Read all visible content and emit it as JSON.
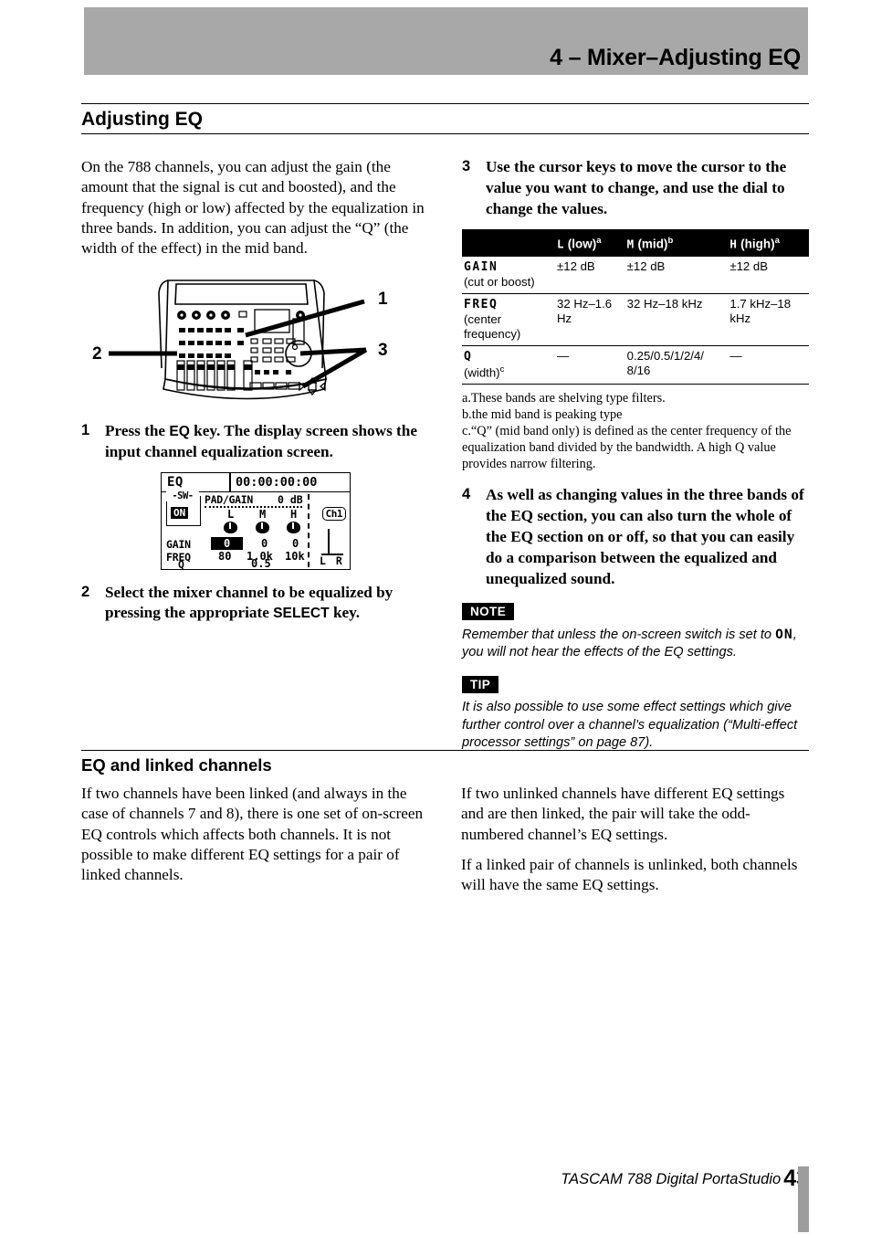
{
  "header": {
    "title": "4 – Mixer–Adjusting EQ",
    "band_color": "#a8a8a8"
  },
  "section": {
    "title": "Adjusting EQ"
  },
  "left_column": {
    "intro": "On the 788 channels, you can adjust the gain (the amount that the signal is cut and boosted), and the frequency (high or low) affected by the equalization in three bands. In addition, you can adjust the “Q” (the width of the effect) in the mid band.",
    "figure_callouts": [
      "1",
      "2",
      "3"
    ],
    "steps": [
      {
        "num": "1",
        "text_before": "Press the ",
        "key": "EQ",
        "text_after": " key. The display screen shows the input channel equalization screen."
      },
      {
        "num": "2",
        "text_before": "Select the mixer channel to be equalized by pressing the appropriate ",
        "key": "SELECT",
        "text_after": " key."
      }
    ]
  },
  "lcd": {
    "screen_title": "EQ",
    "timecode": "00:00:00:00",
    "switch_label": "-SW-",
    "switch_value": "ON",
    "padgain_label": "PAD/GAIN",
    "padgain_value": "0 dB",
    "channel": "Ch1",
    "bands": [
      "L",
      "M",
      "H"
    ],
    "rows": [
      {
        "label": "GAIN",
        "values": [
          "0",
          "0",
          "0"
        ],
        "selected_index": 0
      },
      {
        "label": "FREQ",
        "values": [
          "80",
          "1.0k",
          "10k"
        ],
        "selected_index": -1
      },
      {
        "label": "Q",
        "values": [
          "",
          "0.5",
          ""
        ],
        "selected_index": -1
      }
    ],
    "meter_label": "L R"
  },
  "right_column": {
    "step3": {
      "num": "3",
      "text": "Use the cursor keys to move the cursor to the value you want to change, and use the dial to change the values."
    },
    "step4": {
      "num": "4",
      "text": "As well as changing values in the three bands of the EQ section, you can also turn the whole of the EQ section on or off, so that you can easily do a comparison between the equalized and unequalized sound."
    },
    "note": {
      "tag": "NOTE",
      "text_before": "Remember that unless the on-screen switch is set to ",
      "lcd_token": "ON",
      "text_after": ", you will not hear the effects of the EQ settings."
    },
    "tip": {
      "tag": "TIP",
      "text": "It is also possible to use some effect settings which give further control over a channel’s equalization (“Multi-effect processor settings” on page 87)."
    }
  },
  "spec_table": {
    "columns": [
      {
        "glyph": "",
        "label": ""
      },
      {
        "glyph": "L",
        "label": "(low)",
        "footnote": "a"
      },
      {
        "glyph": "M",
        "label": "(mid)",
        "footnote": "b"
      },
      {
        "glyph": "H",
        "label": "(high)",
        "footnote": "a"
      }
    ],
    "rows": [
      {
        "param": "GAIN",
        "param_sub": "(cut or boost)",
        "param_sub_sup": "",
        "values": [
          "±12 dB",
          "±12 dB",
          "±12 dB"
        ]
      },
      {
        "param": "FREQ",
        "param_sub": "(center frequency)",
        "param_sub_sup": "",
        "values": [
          "32 Hz–1.6 Hz",
          "32 Hz–18 kHz",
          "1.7 kHz–18 kHz"
        ]
      },
      {
        "param": "Q",
        "param_sub": "(width)",
        "param_sub_sup": "c",
        "values": [
          "—",
          "0.25/0.5/1/2/4/ 8/16",
          "—"
        ]
      }
    ],
    "footnotes": [
      "a.These bands are shelving type filters.",
      "b.the mid band is peaking type",
      "c.“Q” (mid band only) is defined as the center frequency of the equalization band divided by the bandwidth. A high Q value provides narrow filtering."
    ]
  },
  "subsection": {
    "title": "EQ and linked channels",
    "left_paragraphs": [
      "If two channels have been linked (and always in the case of channels 7 and 8), there is one set of on-screen EQ controls which affects both channels. It is not possible to make different EQ settings for a pair of linked channels."
    ],
    "right_paragraphs": [
      "If two unlinked channels have different EQ settings and are then linked, the pair will take the odd-numbered channel’s EQ settings.",
      "If a linked pair of channels is unlinked, both channels will have the same EQ settings."
    ]
  },
  "footer": {
    "product": "TASCAM 788 Digital PortaStudio",
    "page": "43"
  }
}
